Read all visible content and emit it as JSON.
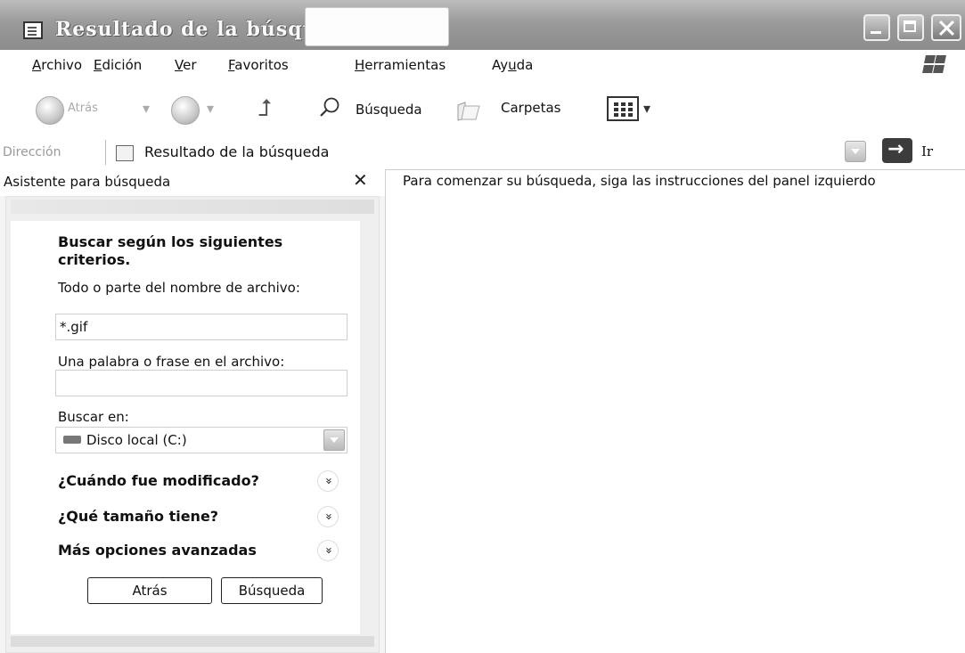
{
  "window": {
    "title": "Resultado de la búsqueda"
  },
  "menu": [
    {
      "pre": "",
      "key": "A",
      "post": "rchivo"
    },
    {
      "pre": "",
      "key": "E",
      "post": "dición"
    },
    {
      "pre": "",
      "key": "V",
      "post": "er"
    },
    {
      "pre": "",
      "key": "F",
      "post": "avoritos"
    },
    {
      "pre": "",
      "key": "H",
      "post": "erramientas"
    },
    {
      "pre": "Ay",
      "key": "u",
      "post": "da"
    }
  ],
  "toolbar": {
    "back_label": "Atrás",
    "search_label": "Búsqueda",
    "folders_label": "Carpetas"
  },
  "address": {
    "label": "Dirección",
    "value": "Resultado de la búsqueda",
    "go_label": "Ir"
  },
  "search_panel": {
    "title": "Asistente para búsqueda",
    "heading": "Buscar según los siguientes criterios.",
    "filename_label": "Todo o parte del nombre de archivo:",
    "filename_value": "*.gif",
    "phrase_label": "Una palabra o frase en el archivo:",
    "phrase_value": "",
    "lookin_label": "Buscar en:",
    "lookin_value": "Disco local (C:)",
    "sections": [
      "¿Cuándo fue modificado?",
      "¿Qué tamaño tiene?",
      "Más opciones avanzadas"
    ],
    "back_button": "Atrás",
    "search_button": "Búsqueda"
  },
  "results_panel": {
    "message": "Para comenzar su búsqueda, siga las instrucciones del panel izquierdo"
  }
}
